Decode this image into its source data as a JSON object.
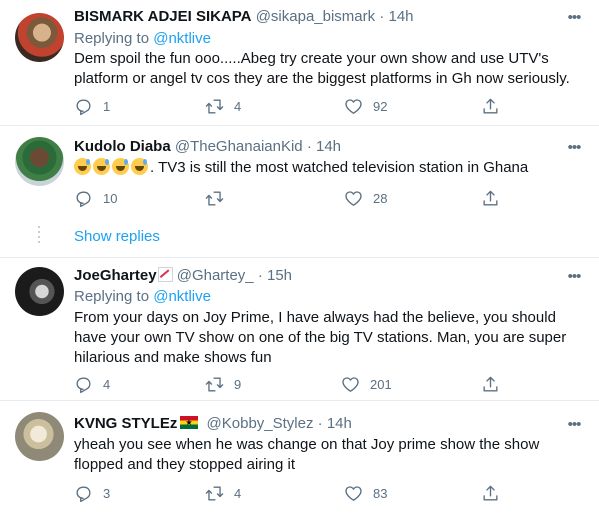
{
  "tweets": [
    {
      "name": "BISMARK ADJEI SIKAPA",
      "handle": "@sikapa_bismark",
      "time": "· 14h",
      "replying_prefix": "Replying to ",
      "replying_to": "@nktlive",
      "text": "Dem spoil the fun ooo.....Abeg try create your own show and use UTV's platform or angel tv cos they are the biggest platforms in Gh now seriously.",
      "replies": "1",
      "retweets": "4",
      "likes": "92"
    },
    {
      "name": "Kudolo Diaba",
      "handle": "@TheGhanaianKid",
      "time": "· 14h",
      "text": ". TV3 is still the most watched television station in Ghana",
      "replies": "10",
      "retweets": "",
      "likes": "28",
      "show_replies": "Show replies"
    },
    {
      "name": "JoeGhartey",
      "handle": "@Ghartey_",
      "time": "· 15h",
      "replying_prefix": "Replying to ",
      "replying_to": "@nktlive",
      "text": "From your days on Joy Prime, I have always had the believe, you should have your own TV show on one of the big TV stations. Man, you are super hilarious and make shows fun",
      "replies": "4",
      "retweets": "9",
      "likes": "201"
    },
    {
      "name": "KVNG STYLEz",
      "handle": "@Kobby_Stylez",
      "time": "· 14h",
      "text": "yheah you see when he was change on that Joy prime show the show flopped and they stopped airing it",
      "replies": "3",
      "retweets": "4",
      "likes": "83"
    }
  ],
  "icons": {
    "more": "more-options-icon",
    "reply": "reply-icon",
    "retweet": "retweet-icon",
    "like": "heart-icon",
    "share": "share-icon"
  },
  "colors": {
    "link": "#1da1f2",
    "secondary_text": "#5b7083",
    "divider": "#e6ecf0"
  }
}
